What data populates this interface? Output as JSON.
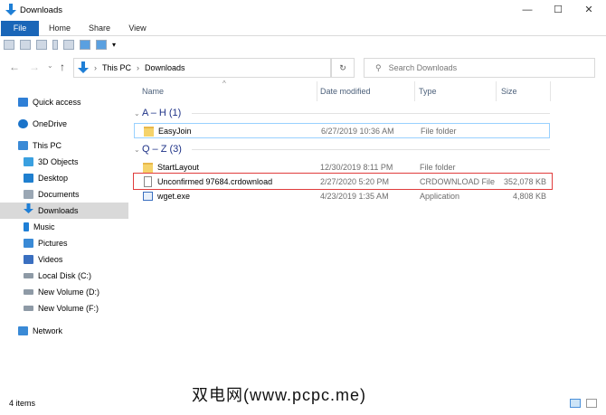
{
  "window": {
    "title": "Downloads",
    "controls": [
      "—",
      "☐",
      "✕"
    ]
  },
  "ribbon": {
    "tabs": [
      "File",
      "Home",
      "Share",
      "View"
    ]
  },
  "address": {
    "path": [
      "This PC",
      "Downloads"
    ],
    "search_placeholder": "Search Downloads"
  },
  "sidebar": {
    "items": [
      {
        "label": "Quick access",
        "icon": "star-icon",
        "color": "#2f7fd6"
      },
      {
        "label": "OneDrive",
        "icon": "cloud-icon",
        "color": "#1a73c9"
      },
      {
        "label": "This PC",
        "icon": "computer-icon",
        "color": "#3a8ad6"
      },
      {
        "label": "3D Objects",
        "icon": "cube-icon",
        "color": "#3aa0e0"
      },
      {
        "label": "Desktop",
        "icon": "desktop-icon",
        "color": "#1f7fcf"
      },
      {
        "label": "Documents",
        "icon": "document-icon",
        "color": "#9aa7b4"
      },
      {
        "label": "Downloads",
        "icon": "download-icon",
        "color": "#1f7fd6",
        "selected": true
      },
      {
        "label": "Music",
        "icon": "music-icon",
        "color": "#1f7fd6"
      },
      {
        "label": "Pictures",
        "icon": "pictures-icon",
        "color": "#3a8ad6"
      },
      {
        "label": "Videos",
        "icon": "video-icon",
        "color": "#3a6fc0"
      },
      {
        "label": "Local Disk (C:)",
        "icon": "drive-icon",
        "color": "#8e9aa6"
      },
      {
        "label": "New Volume (D:)",
        "icon": "drive-icon",
        "color": "#8e9aa6"
      },
      {
        "label": "New Volume (F:)",
        "icon": "drive-icon",
        "color": "#8e9aa6"
      },
      {
        "label": "Network",
        "icon": "network-icon",
        "color": "#3a8ad6"
      }
    ]
  },
  "columns": [
    "Name",
    "Date modified",
    "Type",
    "Size"
  ],
  "groups": [
    {
      "label": "A – H (1)",
      "files": [
        {
          "name": "EasyJoin",
          "date": "6/27/2019 10:36 AM",
          "type": "File folder",
          "size": "",
          "kind": "folder"
        }
      ]
    },
    {
      "label": "Q – Z (3)",
      "files": [
        {
          "name": "StartLayout",
          "date": "12/30/2019 8:11 PM",
          "type": "File folder",
          "size": "",
          "kind": "folder"
        },
        {
          "name": "Unconfirmed 97684.crdownload",
          "date": "2/27/2020 5:20 PM",
          "type": "CRDOWNLOAD File",
          "size": "352,078 KB",
          "kind": "file"
        },
        {
          "name": "wget.exe",
          "date": "4/23/2019 1:35 AM",
          "type": "Application",
          "size": "4,808 KB",
          "kind": "exe"
        }
      ]
    }
  ],
  "status": "4 items",
  "watermark": "双电网(www.pcpc.me)",
  "colors": {
    "accent": "#1a66b8",
    "highlight": "#e03c3c",
    "group": "#1e3287"
  }
}
